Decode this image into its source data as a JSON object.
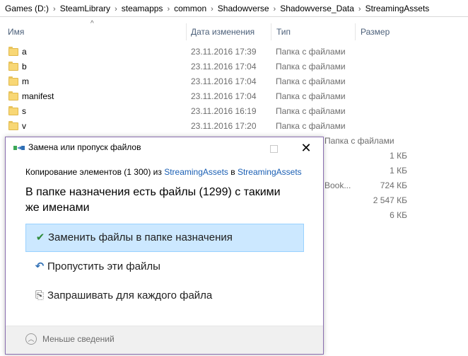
{
  "breadcrumb": [
    "Games (D:)",
    "SteamLibrary",
    "steamapps",
    "common",
    "Shadowverse",
    "Shadowverse_Data",
    "StreamingAssets"
  ],
  "columns": {
    "name": "Имя",
    "date": "Дата изменения",
    "type": "Тип",
    "size": "Размер"
  },
  "files": [
    {
      "name": "a",
      "date": "23.11.2016 17:39",
      "type": "Папка с файлами"
    },
    {
      "name": "b",
      "date": "23.11.2016 17:04",
      "type": "Папка с файлами"
    },
    {
      "name": "m",
      "date": "23.11.2016 17:04",
      "type": "Папка с файлами"
    },
    {
      "name": "manifest",
      "date": "23.11.2016 17:04",
      "type": "Папка с файлами"
    },
    {
      "name": "s",
      "date": "23.11.2016 16:19",
      "type": "Папка с файлами"
    },
    {
      "name": "v",
      "date": "23.11.2016 17:20",
      "type": "Папка с файлами"
    }
  ],
  "partial_rows": [
    {
      "type": "Папка с файлами",
      "size": ""
    },
    {
      "type": "",
      "size": "1 КБ"
    },
    {
      "type": "",
      "size": "1 КБ"
    },
    {
      "type": "Book...",
      "size": "724 КБ"
    },
    {
      "type": "",
      "size": "2 547 КБ"
    },
    {
      "type": "",
      "size": "6 КБ"
    }
  ],
  "dialog": {
    "title": "Замена или пропуск файлов",
    "copy_prefix": "Копирование элементов (1 300) из ",
    "copy_source": "StreamingAssets",
    "copy_mid": " в ",
    "copy_dest": "StreamingAssets",
    "heading": "В папке назначения есть файлы (1299) с такими же именами",
    "options": {
      "replace": "Заменить файлы в папке назначения",
      "skip": "Пропустить эти файлы",
      "decide": "Запрашивать для каждого файла"
    },
    "less_details": "Меньше сведений"
  },
  "colors": {
    "accent": "#1a5fb4",
    "selected_bg": "#cce8ff",
    "dialog_border": "#8a6fb0"
  }
}
